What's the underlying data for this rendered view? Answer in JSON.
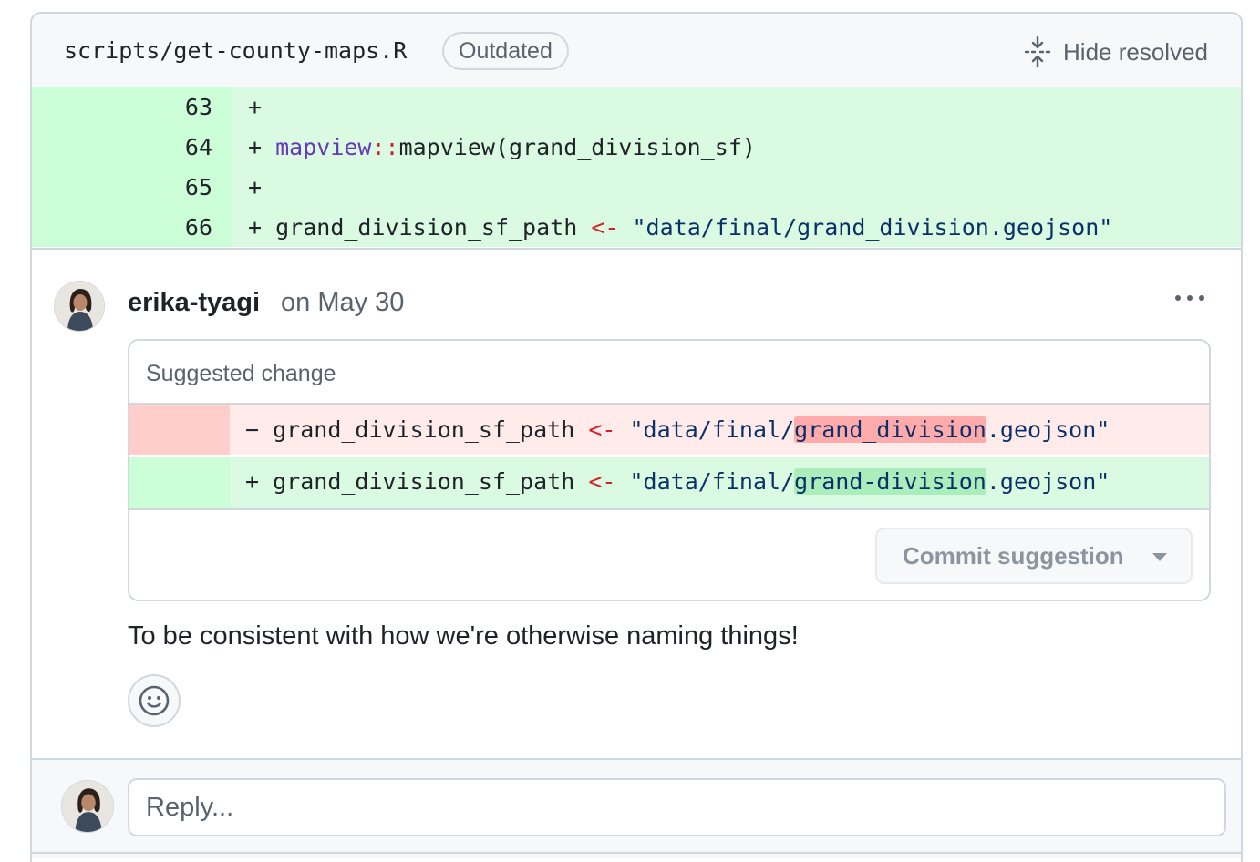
{
  "file_header": {
    "path": "scripts/get-county-maps.R",
    "badge": "Outdated",
    "hide_resolved_label": "Hide resolved",
    "hide_resolved_icon": "unfold-icon"
  },
  "diff": {
    "lines": [
      {
        "number": "63",
        "sign": "+",
        "code": ""
      },
      {
        "number": "64",
        "sign": "+",
        "pkg": "mapview",
        "op": "::",
        "rest": "mapview(grand_division_sf)"
      },
      {
        "number": "65",
        "sign": "+",
        "code": ""
      },
      {
        "number": "66",
        "sign": "+",
        "var": "grand_division_sf_path",
        "assign": "<-",
        "str": "\"data/final/grand_division.geojson\""
      }
    ]
  },
  "comment": {
    "author": "erika-tyagi",
    "date": "on May 30",
    "more_icon": "kebab-horizontal-icon",
    "suggestion": {
      "title": "Suggested change",
      "deleted": {
        "sign": "−",
        "var": "grand_division_sf_path",
        "assign": "<-",
        "str_prefix": "\"data/final/",
        "str_changed": "grand_division",
        "str_suffix": ".geojson\""
      },
      "added": {
        "sign": "+",
        "var": "grand_division_sf_path",
        "assign": "<-",
        "str_prefix": "\"data/final/",
        "str_changed": "grand-division",
        "str_suffix": ".geojson\""
      },
      "commit_label": "Commit suggestion"
    },
    "body": "To be consistent with how we're otherwise naming things!",
    "reaction_icon": "smiley-icon"
  },
  "reply": {
    "placeholder": "Reply..."
  },
  "colors": {
    "addition_bg": "#dafbe1",
    "addition_gutter": "#ccffd8",
    "deletion_bg": "#ffebe9",
    "deletion_gutter": "#ffcecb",
    "border": "#d0d7de",
    "muted_text": "#59636e"
  }
}
